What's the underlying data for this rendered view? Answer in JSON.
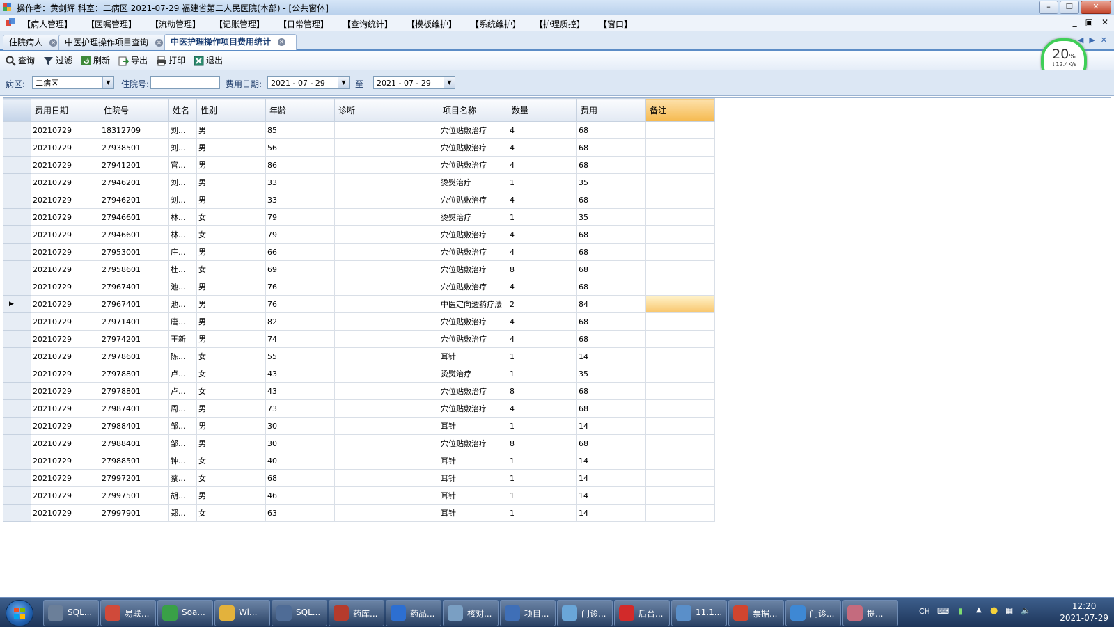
{
  "window": {
    "title": "操作者：黄剑辉  科室：二病区  2021-07-29  福建省第二人民医院(本部) - [公共窗体]",
    "min_icon": "minimize-icon",
    "max_icon": "restore-icon",
    "close_icon": "close-icon"
  },
  "menu": {
    "items": [
      "【病人管理】",
      "【医嘱管理】",
      "【流动管理】",
      "【记账管理】",
      "【日常管理】",
      "【查询统计】",
      "【模板维护】",
      "【系统维护】",
      "【护理质控】",
      "【窗口】"
    ],
    "mdi": [
      "_",
      "▣",
      "✕"
    ]
  },
  "tabs": [
    {
      "label": "住院病人"
    },
    {
      "label": "中医护理操作项目查询"
    },
    {
      "label": "中医护理操作项目费用统计",
      "active": true
    }
  ],
  "tabnav": [
    "◀",
    "▶",
    "✕"
  ],
  "toolbar": {
    "query": "查询",
    "filter": "过滤",
    "refresh": "刷新",
    "export": "导出",
    "print": "打印",
    "exit": "退出"
  },
  "filters": {
    "ward_label": "病区:",
    "ward_value": "二病区",
    "inpatient_label": "住院号:",
    "inpatient_value": "",
    "date_label": "费用日期:",
    "date_from": "2021 - 07 - 29",
    "to_label": "至",
    "date_to": "2021 - 07 - 29"
  },
  "grid": {
    "columns": [
      "费用日期",
      "住院号",
      "姓名",
      "性别",
      "年龄",
      "诊断",
      "项目名称",
      "数量",
      "费用",
      "备注"
    ],
    "selected_row": 10,
    "rows": [
      [
        "20210729",
        "18312709",
        "刘...",
        "男",
        "85",
        "",
        "穴位贴敷治疗",
        "4",
        "68",
        ""
      ],
      [
        "20210729",
        "27938501",
        "刘...",
        "男",
        "56",
        "",
        "穴位贴敷治疗",
        "4",
        "68",
        ""
      ],
      [
        "20210729",
        "27941201",
        "官...",
        "男",
        "86",
        "",
        "穴位贴敷治疗",
        "4",
        "68",
        ""
      ],
      [
        "20210729",
        "27946201",
        "刘...",
        "男",
        "33",
        "",
        "烫熨治疗",
        "1",
        "35",
        ""
      ],
      [
        "20210729",
        "27946201",
        "刘...",
        "男",
        "33",
        "",
        "穴位贴敷治疗",
        "4",
        "68",
        ""
      ],
      [
        "20210729",
        "27946601",
        "林...",
        "女",
        "79",
        "",
        "烫熨治疗",
        "1",
        "35",
        ""
      ],
      [
        "20210729",
        "27946601",
        "林...",
        "女",
        "79",
        "",
        "穴位贴敷治疗",
        "4",
        "68",
        ""
      ],
      [
        "20210729",
        "27953001",
        "庄...",
        "男",
        "66",
        "",
        "穴位贴敷治疗",
        "4",
        "68",
        ""
      ],
      [
        "20210729",
        "27958601",
        "杜...",
        "女",
        "69",
        "",
        "穴位贴敷治疗",
        "8",
        "68",
        ""
      ],
      [
        "20210729",
        "27967401",
        "池...",
        "男",
        "76",
        "",
        "穴位贴敷治疗",
        "4",
        "68",
        ""
      ],
      [
        "20210729",
        "27967401",
        "池...",
        "男",
        "76",
        "",
        "中医定向透药疗法",
        "2",
        "84",
        ""
      ],
      [
        "20210729",
        "27971401",
        "唐...",
        "男",
        "82",
        "",
        "穴位贴敷治疗",
        "4",
        "68",
        ""
      ],
      [
        "20210729",
        "27974201",
        "王新",
        "男",
        "74",
        "",
        "穴位贴敷治疗",
        "4",
        "68",
        ""
      ],
      [
        "20210729",
        "27978601",
        "陈...",
        "女",
        "55",
        "",
        "耳针",
        "1",
        "14",
        ""
      ],
      [
        "20210729",
        "27978801",
        "卢...",
        "女",
        "43",
        "",
        "烫熨治疗",
        "1",
        "35",
        ""
      ],
      [
        "20210729",
        "27978801",
        "卢...",
        "女",
        "43",
        "",
        "穴位贴敷治疗",
        "8",
        "68",
        ""
      ],
      [
        "20210729",
        "27987401",
        "周...",
        "男",
        "73",
        "",
        "穴位贴敷治疗",
        "4",
        "68",
        ""
      ],
      [
        "20210729",
        "27988401",
        "邹...",
        "男",
        "30",
        "",
        "耳针",
        "1",
        "14",
        ""
      ],
      [
        "20210729",
        "27988401",
        "邹...",
        "男",
        "30",
        "",
        "穴位贴敷治疗",
        "8",
        "68",
        ""
      ],
      [
        "20210729",
        "27988501",
        "钟...",
        "女",
        "40",
        "",
        "耳针",
        "1",
        "14",
        ""
      ],
      [
        "20210729",
        "27997201",
        "蔡...",
        "女",
        "68",
        "",
        "耳针",
        "1",
        "14",
        ""
      ],
      [
        "20210729",
        "27997501",
        "胡...",
        "男",
        "46",
        "",
        "耳针",
        "1",
        "14",
        ""
      ],
      [
        "20210729",
        "27997901",
        "郑...",
        "女",
        "63",
        "",
        "耳针",
        "1",
        "14",
        ""
      ]
    ]
  },
  "net_monitor": {
    "percent": "20",
    "percent_unit": "%",
    "speed": "↓12.4K/s"
  },
  "taskbar": {
    "tasks": [
      {
        "label": "SQL...",
        "icon": "sql-icon",
        "color": "#6b7f99"
      },
      {
        "label": "易联...",
        "icon": "chrome-icon",
        "color": "#d04a3a"
      },
      {
        "label": "Soa...",
        "icon": "soapui-icon",
        "color": "#39a047"
      },
      {
        "label": "Wi...",
        "icon": "folder-icon",
        "color": "#e3b23c"
      },
      {
        "label": "SQL...",
        "icon": "sql-icon",
        "color": "#4f6c96"
      },
      {
        "label": "药库...",
        "icon": "pharmacy-icon",
        "color": "#b53b2c"
      },
      {
        "label": "药品...",
        "icon": "wps-icon",
        "color": "#2d6fd1"
      },
      {
        "label": "核对...",
        "icon": "document-icon",
        "color": "#7a9fc3"
      },
      {
        "label": "项目...",
        "icon": "yuan-icon",
        "color": "#3f6fb7"
      },
      {
        "label": "门诊...",
        "icon": "clinic-icon",
        "color": "#6aa6d8"
      },
      {
        "label": "后台...",
        "icon": "red-cross-icon",
        "color": "#d22a2a"
      },
      {
        "label": "11.1...",
        "icon": "folder-image-icon",
        "color": "#5a8fc9"
      },
      {
        "label": "票据...",
        "icon": "receipt-icon",
        "color": "#d0452f"
      },
      {
        "label": "门诊...",
        "icon": "globe-icon",
        "color": "#3e88d4"
      },
      {
        "label": "提...",
        "icon": "nurse-icon",
        "color": "#c46b7e"
      }
    ],
    "lang": "CH",
    "time": "12:20",
    "date": "2021-07-29"
  }
}
